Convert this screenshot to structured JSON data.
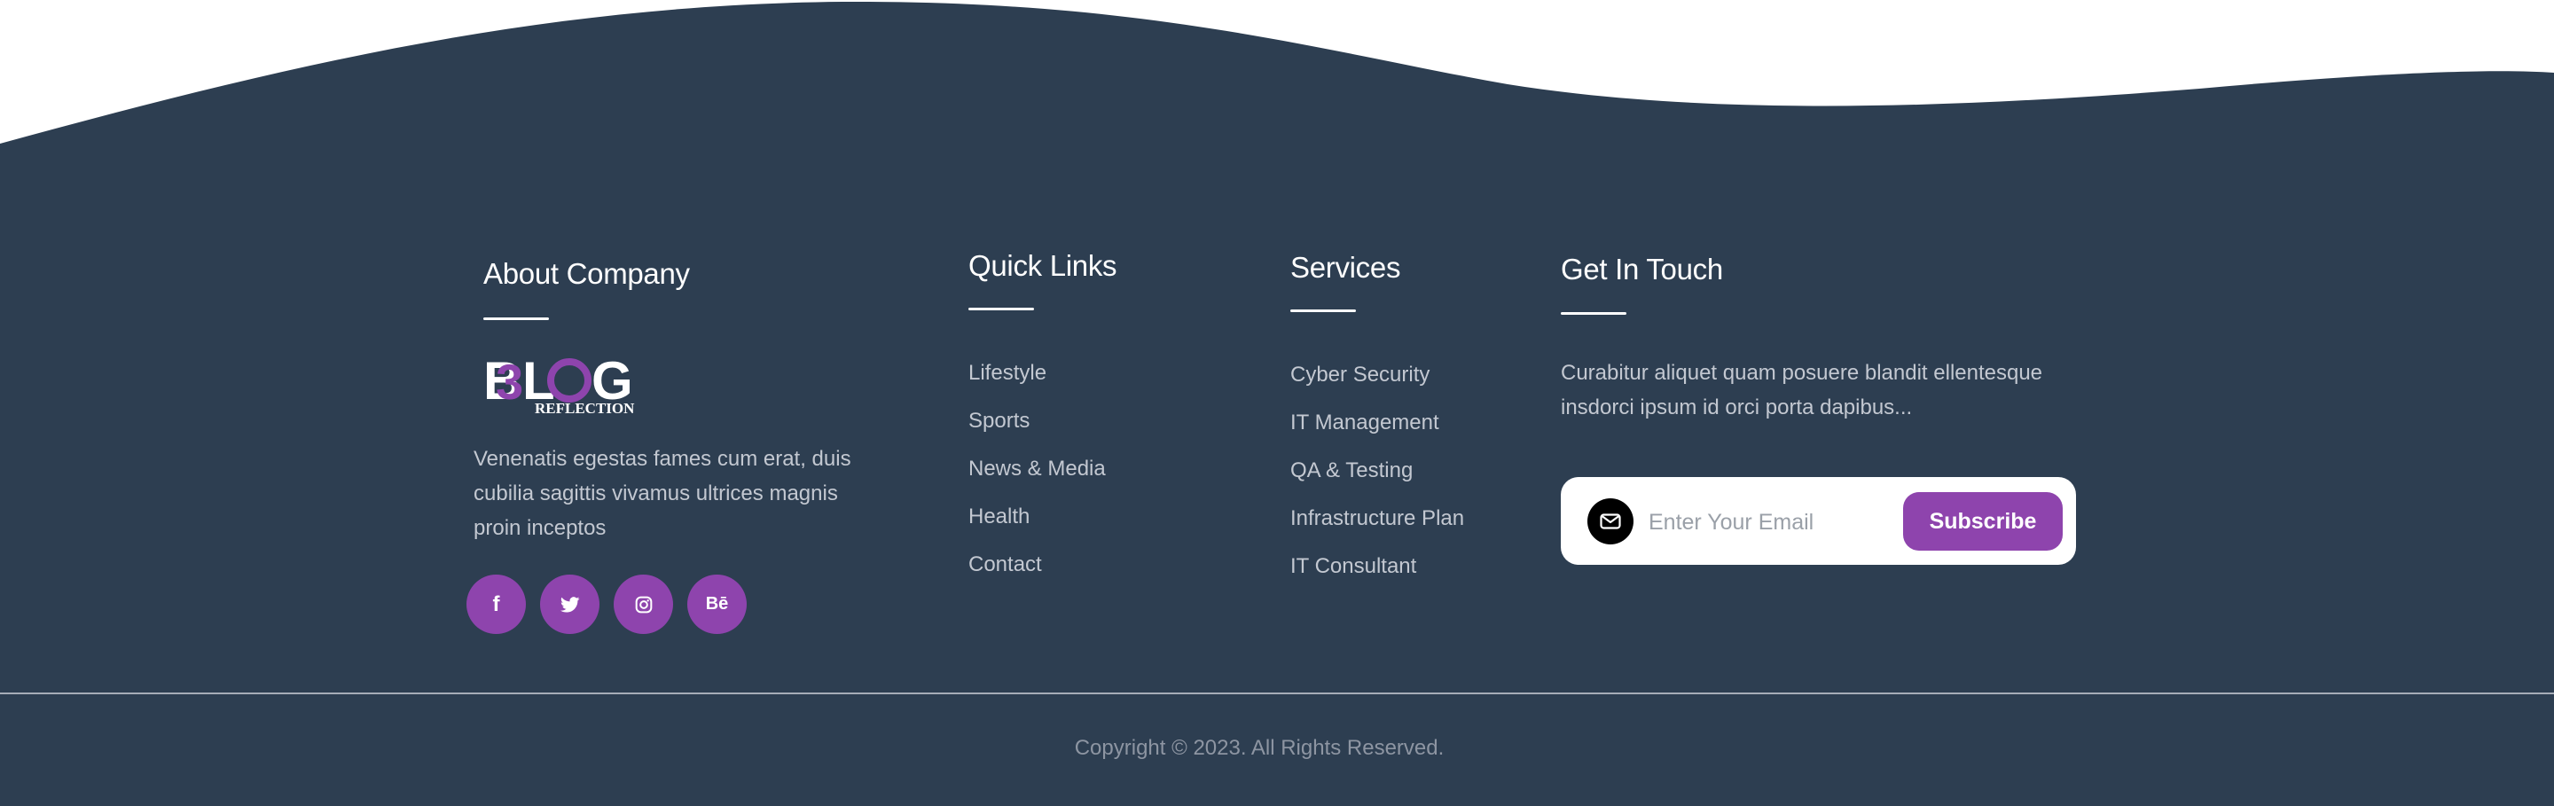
{
  "colors": {
    "footer_bg": "#2d3e51",
    "accent": "#8e44ad",
    "text_muted": "#c3c8d1",
    "heading": "#ffffff",
    "copyright": "#8d95a2"
  },
  "about": {
    "heading": "About Company",
    "logo": {
      "main": "BLOG",
      "sub": "REFLECTION"
    },
    "text": "Venenatis egestas fames cum erat, duis cubilia sagittis vivamus ultrices magnis proin inceptos",
    "socials": [
      {
        "icon": "facebook-icon",
        "glyph": "f"
      },
      {
        "icon": "twitter-icon",
        "glyph": "bird"
      },
      {
        "icon": "instagram-icon",
        "glyph": "camera"
      },
      {
        "icon": "behance-icon",
        "glyph": "Bē"
      }
    ]
  },
  "quick_links": {
    "heading": "Quick Links",
    "items": [
      "Lifestyle",
      "Sports",
      "News & Media",
      "Health",
      "Contact"
    ]
  },
  "services": {
    "heading": "Services",
    "items": [
      "Cyber Security",
      "IT Management",
      "QA & Testing",
      "Infrastructure Plan",
      "IT Consultant"
    ]
  },
  "touch": {
    "heading": "Get In Touch",
    "text": "Curabitur aliquet quam posuere blandit ellentesque insdorci ipsum id orci porta dapibus...",
    "email_placeholder": "Enter Your Email",
    "email_value": "",
    "subscribe_label": "Subscribe",
    "mail_icon": "envelope-icon"
  },
  "copyright": "Copyright © 2023. All Rights Reserved."
}
